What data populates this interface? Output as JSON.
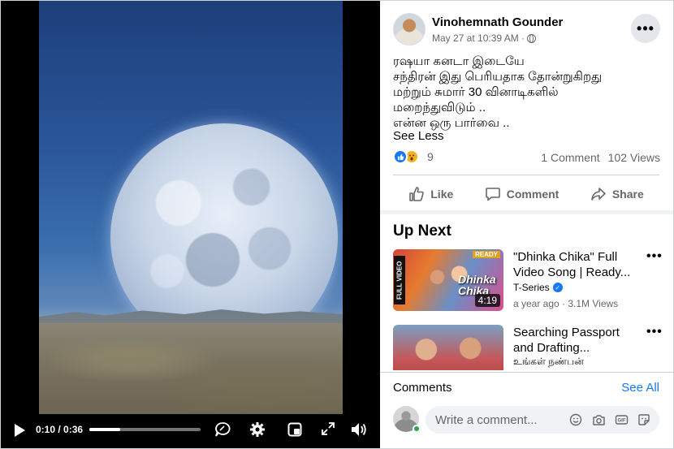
{
  "player": {
    "time_display": "0:10 / 0:36",
    "progress": 0.28
  },
  "post": {
    "author": "Vinohemnath Gounder",
    "date": "May 27 at 10:39 AM ·",
    "text_lines": [
      "ரஷயா கனடா இடையே",
      "சந்திரன் இது பெரியதாக தோன்றுகிறது",
      "மற்றும் சுமார் 30 வினாடிகளில்",
      "மறைந்துவிடும் ..",
      "என்ன ஒரு பார்வை .."
    ],
    "see_less": "See Less",
    "reaction_count": "9",
    "comment_count": "1 Comment",
    "views": "102 Views"
  },
  "actions": {
    "like": "Like",
    "comment": "Comment",
    "share": "Share"
  },
  "up_next": {
    "title": "Up Next",
    "items": [
      {
        "title_line1": "\"Dhinka Chika\" Full",
        "title_line2": "Video Song | Ready...",
        "channel": "T-Series",
        "meta": "a year ago · 3.1M Views",
        "duration": "4:19",
        "thumb_badge": "FULL VIDEO",
        "thumb_text": "Dhinka Chika",
        "thumb_tag": "READY"
      },
      {
        "title_line1": "Searching Passport",
        "title_line2": "and Drafting...",
        "channel": "உங்கள் நண்பன்"
      }
    ]
  },
  "comments": {
    "heading": "Comments",
    "see_all": "See All",
    "placeholder": "Write a comment..."
  },
  "colors": {
    "accent": "#1877f2",
    "secondary_text": "#65676b",
    "online": "#31a24c"
  }
}
